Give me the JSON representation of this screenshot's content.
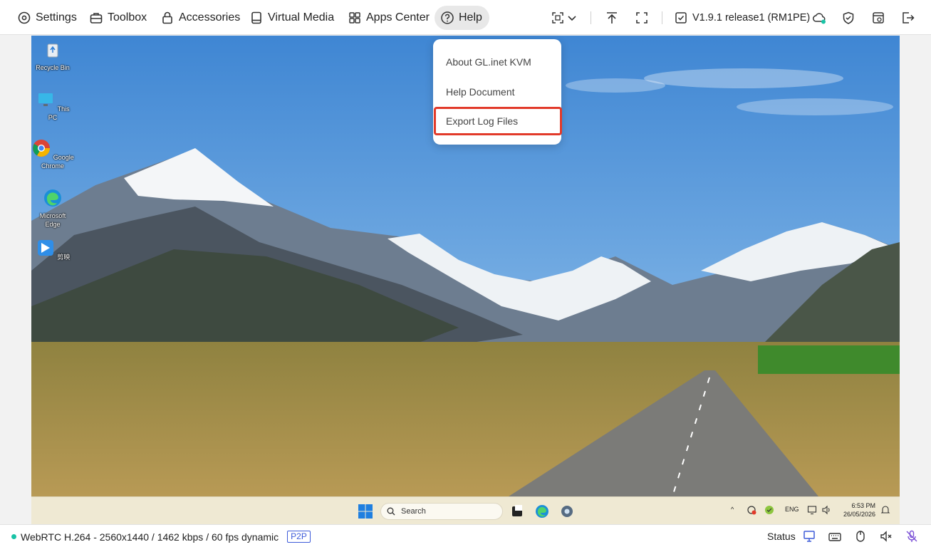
{
  "nav": {
    "settings": "Settings",
    "toolbox": "Toolbox",
    "accessories": "Accessories",
    "virtual_media": "Virtual Media",
    "apps_center": "Apps Center",
    "help": "Help"
  },
  "toolbar": {
    "version": "V1.9.1 release1 (RM1PE)",
    "icons": [
      "screen-capture-icon",
      "chevron-down-icon",
      "upload-icon",
      "fullscreen-icon",
      "version-check-icon",
      "cloud-icon",
      "shield-icon",
      "tabs-icon",
      "logout-icon"
    ]
  },
  "help_menu": {
    "items": [
      "About GL.inet KVM",
      "Help Document",
      "Export Log Files"
    ],
    "highlighted": "Export Log Files"
  },
  "desktop": {
    "icons": [
      "Recycle Bin",
      "This PC",
      "Google Chrome",
      "Microsoft Edge",
      "剪映"
    ],
    "taskbar": {
      "search_placeholder": "Search",
      "lang": "ENG",
      "time": "6:53 PM",
      "date": "26/05/2026"
    }
  },
  "statusbar": {
    "stream_info": "WebRTC H.264 - 2560x1440 / 1462 kbps / 60 fps dynamic",
    "mode_badge": "P2P",
    "status_label": "Status"
  },
  "colors": {
    "accent": "#19c3a6",
    "highlight_border": "#e23a2a",
    "badge": "#3d5bd9"
  }
}
